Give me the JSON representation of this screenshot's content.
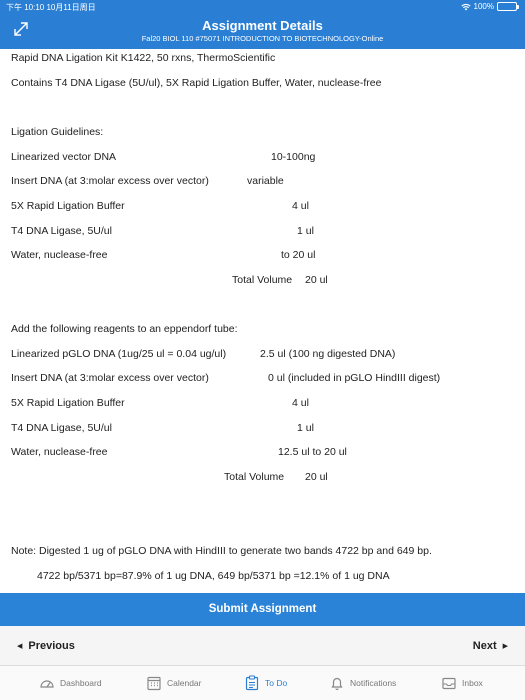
{
  "status": {
    "time": "下午 10:10  10月11日周日",
    "battery": "100%"
  },
  "header": {
    "title": "Assignment Details",
    "subtitle": "Fal20 BIOL 110 #75071 INTRODUCTION TO BIOTECHNOLOGY-Online"
  },
  "content": {
    "kit_line": "Rapid DNA Ligation Kit K1422, 50 rxns, ThermoScientific",
    "contains_line": "Contains T4 DNA Ligase (5U/ul), 5X Rapid Ligation Buffer, Water, nuclease-free",
    "guidelines_title": "Ligation Guidelines:",
    "guidelines": [
      {
        "label": "Linearized vector DNA",
        "value": "10-100ng"
      },
      {
        "label": "Insert DNA (at 3:molar excess over vector)",
        "value": "variable"
      },
      {
        "label": "5X Rapid Ligation Buffer",
        "value": "4 ul"
      },
      {
        "label": "T4 DNA Ligase, 5U/ul",
        "value": "1 ul"
      },
      {
        "label": "Water, nuclease-free",
        "value": "to 20 ul"
      }
    ],
    "guidelines_total_label": "Total Volume",
    "guidelines_total_value": "20 ul",
    "reagents_title": "Add the following reagents to an eppendorf tube:",
    "reagents": [
      {
        "label": "Linearized pGLO DNA (1ug/25 ul = 0.04 ug/ul)",
        "value": "2.5 ul  (100 ng digested DNA)"
      },
      {
        "label": "Insert DNA (at 3:molar excess over vector)",
        "value": "0 ul  (included in pGLO HindIII digest)"
      },
      {
        "label": "5X Rapid Ligation Buffer",
        "value": "4 ul"
      },
      {
        "label": "T4 DNA Ligase, 5U/ul",
        "value": "1 ul"
      },
      {
        "label": "Water, nuclease-free",
        "value": "12.5 ul to 20 ul"
      }
    ],
    "reagents_total_label": "Total Volume",
    "reagents_total_value": "20 ul",
    "note": "Note: Digested 1 ug of pGLO DNA with HindIII to generate two bands 4722 bp and 649 bp.",
    "note_calc": "4722 bp/5371 bp=87.9% of 1 ug DNA, 649 bp/5371 bp =12.1% of 1 ug DNA"
  },
  "submit_label": "Submit Assignment",
  "nav": {
    "previous": "Previous",
    "next": "Next"
  },
  "tabs": [
    {
      "label": "Dashboard",
      "icon": "dashboard-icon"
    },
    {
      "label": "Calendar",
      "icon": "calendar-icon"
    },
    {
      "label": "To Do",
      "icon": "todo-icon",
      "active": true
    },
    {
      "label": "Notifications",
      "icon": "bell-icon"
    },
    {
      "label": "Inbox",
      "icon": "inbox-icon"
    }
  ],
  "colors": {
    "header": "#2a7fd4",
    "submit": "#2a83d6",
    "active_tab": "#2a7fd4"
  }
}
